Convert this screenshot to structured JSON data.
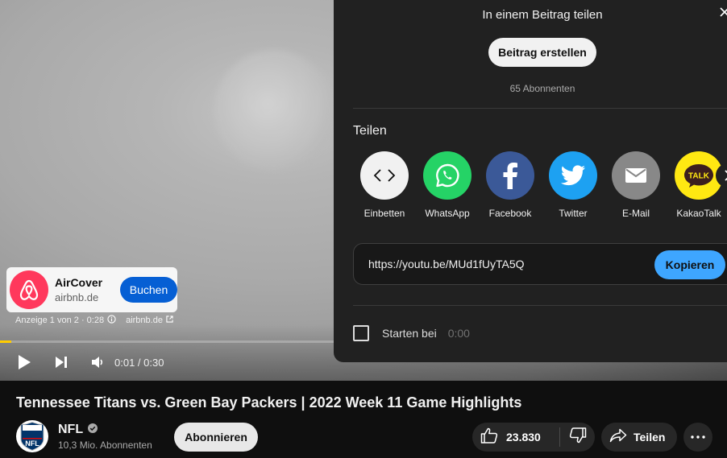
{
  "ad": {
    "brand": "AirCover",
    "domain": "airbnb.de",
    "cta": "Buchen",
    "info_counter": "Anzeige 1 von 2 · 0:28",
    "info_domain": "airbnb.de"
  },
  "player": {
    "current_time": "0:01",
    "duration": "0:30",
    "time_display": "0:01 / 0:30",
    "progress_fraction": 0.033
  },
  "share_panel": {
    "post_title": "In einem Beitrag teilen",
    "create_post_label": "Beitrag erstellen",
    "subscribers": "65 Abonnenten",
    "share_label": "Teilen",
    "targets": [
      {
        "label": "Einbetten",
        "icon": "embed-icon",
        "color": "#f1f1f1"
      },
      {
        "label": "WhatsApp",
        "icon": "whatsapp-icon",
        "color": "#25d366"
      },
      {
        "label": "Facebook",
        "icon": "facebook-icon",
        "color": "#3b5998"
      },
      {
        "label": "Twitter",
        "icon": "twitter-icon",
        "color": "#1da1f2"
      },
      {
        "label": "E-Mail",
        "icon": "email-icon",
        "color": "#888888"
      },
      {
        "label": "KakaoTalk",
        "icon": "kakaotalk-icon",
        "color": "#ffe812"
      }
    ],
    "url": "https://youtu.be/MUd1fUyTA5Q",
    "copy_label": "Kopieren",
    "start_label": "Starten bei",
    "start_time": "0:00"
  },
  "video": {
    "title": "Tennessee Titans vs. Green Bay Packers | 2022 Week 11 Game Highlights"
  },
  "channel": {
    "name": "NFL",
    "subscribers": "10,3 Mio. Abonnenten",
    "subscribe_label": "Abonnieren",
    "verified": true
  },
  "actions": {
    "like_count": "23.830",
    "share_label": "Teilen"
  },
  "colors": {
    "accent_blue": "#3ea6ff",
    "ad_progress": "#ffcc00",
    "ad_button": "#065fd4",
    "airbnb": "#ff385c"
  }
}
